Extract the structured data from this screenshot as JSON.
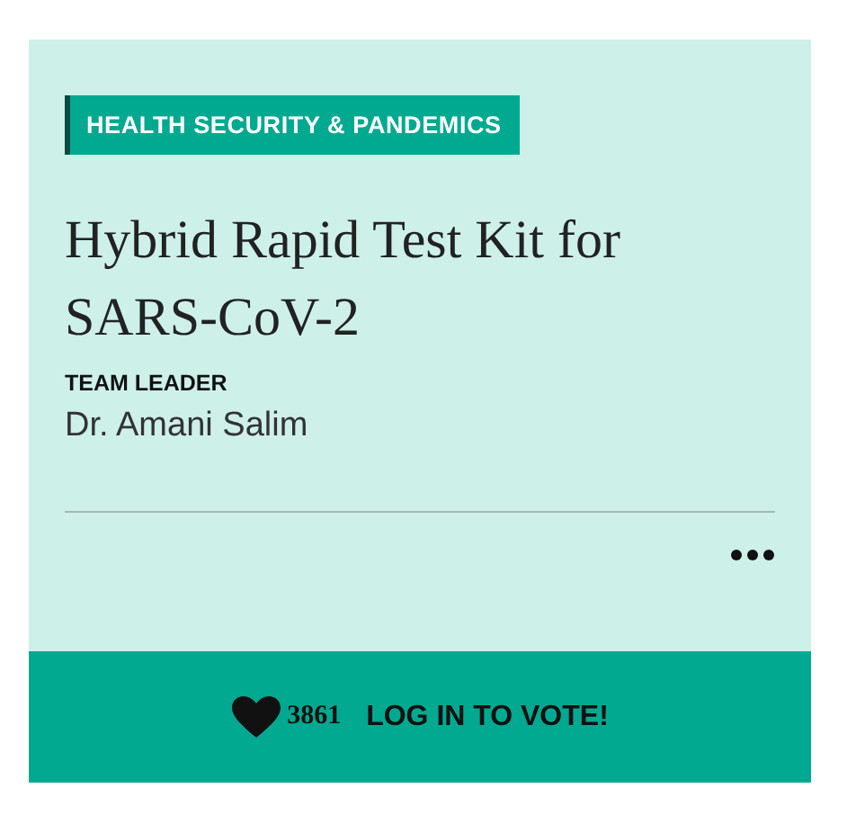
{
  "card": {
    "category": "HEALTH SECURITY & PANDEMICS",
    "title": "Hybrid Rapid Test Kit for SARS-CoV-2",
    "leader_label": "TEAM LEADER",
    "leader_name": "Dr. Amani Salim",
    "vote_count": "3861",
    "vote_action": "LOG IN TO VOTE!"
  }
}
